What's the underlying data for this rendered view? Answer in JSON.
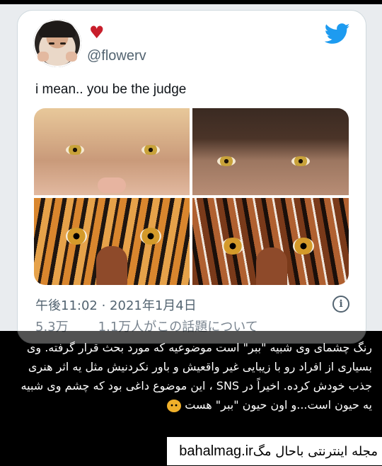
{
  "tweet": {
    "handle": "@flowerv",
    "text": "i mean.. you be the judge",
    "timestamp": "午後11:02 · 2021年1月4日",
    "stats_likes": "5.3万",
    "stats_replies": "1.1万人がこの話題について",
    "icons": {
      "heart": "heart-icon",
      "brand": "twitter-bird-icon",
      "info": "info-icon"
    }
  },
  "caption": {
    "text": "رنگ چشمای وی  شبیه \"ببر\" است موضوعیه که مورد بحث قرار گرفته. وی بسیاری از افراد رو با زیبایی غیر واقعیش و باور نکردنیش مثل یه اثر هنری جذب خودش کرده. اخیراً در SNS ، این موضوع داغی بود که چشم وی شبیه یه حیون است...و اون حیون \"ببر\" هست"
  },
  "brand": {
    "url": "bahalmag.ir",
    "name": "مجله اینترنتی باحال مگ"
  },
  "colors": {
    "accent": "#1d9bf0",
    "heart": "#c81e2b"
  }
}
